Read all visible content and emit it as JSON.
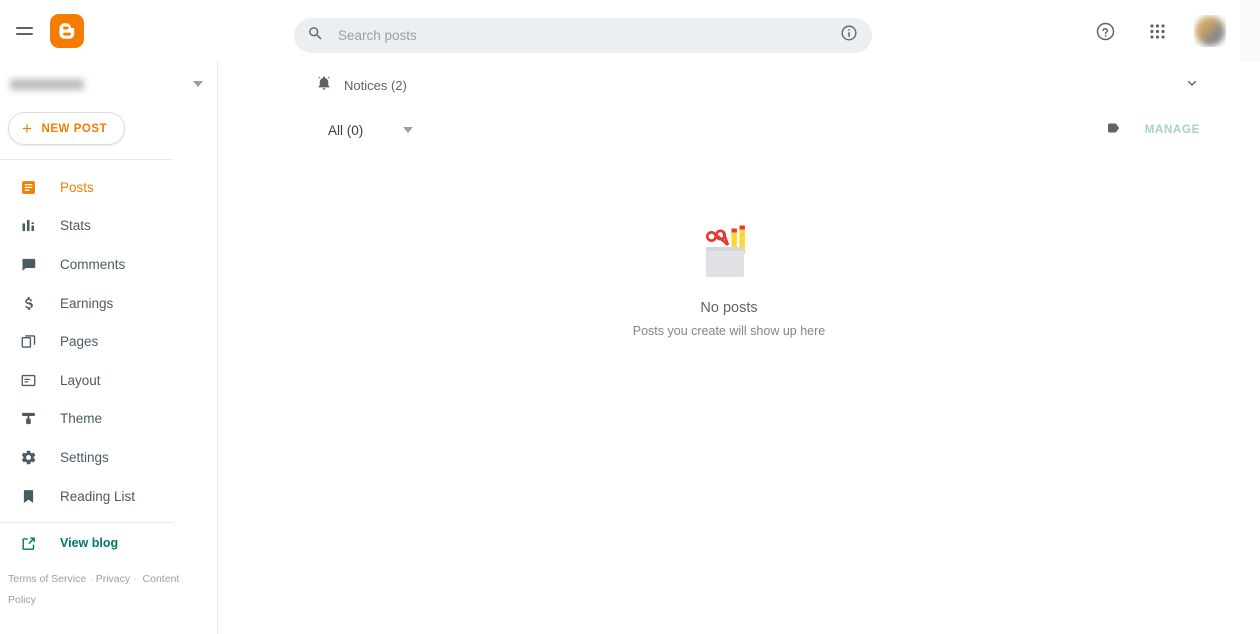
{
  "topbar": {
    "menu_icon": "hamburger-menu-icon",
    "logo_icon": "blogger-logo-icon",
    "logo_color": "#f57c00",
    "search": {
      "placeholder": "Search posts",
      "value": "",
      "search_icon": "search-icon",
      "info_icon": "info-circle-icon"
    },
    "help_icon": "help-circle-icon",
    "apps_icon": "apps-grid-icon",
    "avatar": "user-avatar"
  },
  "sidebar": {
    "blog_selector": {
      "name": "",
      "caret_icon": "chevron-down-icon"
    },
    "new_post": {
      "label": "NEW POST",
      "plus": "+"
    },
    "items": [
      {
        "label": "Posts",
        "icon": "posts-icon",
        "active": true
      },
      {
        "label": "Stats",
        "icon": "stats-icon",
        "active": false
      },
      {
        "label": "Comments",
        "icon": "comments-icon",
        "active": false
      },
      {
        "label": "Earnings",
        "icon": "earnings-icon",
        "active": false
      },
      {
        "label": "Pages",
        "icon": "pages-icon",
        "active": false
      },
      {
        "label": "Layout",
        "icon": "layout-icon",
        "active": false
      },
      {
        "label": "Theme",
        "icon": "theme-icon",
        "active": false
      },
      {
        "label": "Settings",
        "icon": "settings-icon",
        "active": false
      },
      {
        "label": "Reading List",
        "icon": "reading-list-icon",
        "active": false
      }
    ],
    "view_blog": {
      "label": "View blog",
      "icon": "external-link-icon",
      "color": "#00796b"
    },
    "footer": {
      "terms": "Terms of Service",
      "privacy": "Privacy",
      "content_policy": "Content Policy",
      "separator": "·"
    }
  },
  "main": {
    "notices": {
      "label": "Notices (2)",
      "bell_icon": "bell-icon",
      "chevron_icon": "chevron-down-icon"
    },
    "filter": {
      "label": "All (0)",
      "caret_icon": "chevron-down-icon",
      "tag_icon": "label-tag-icon",
      "manage_label": "MANAGE",
      "manage_color": "#a7cfcb"
    },
    "empty": {
      "illustration": "pencil-cup-illustration",
      "title": "No posts",
      "subtitle": "Posts you create will show up here"
    }
  },
  "colors": {
    "accent_orange": "#f57c00",
    "teal": "#00796b",
    "slate": "#4b5b63",
    "search_bg": "#eceff1"
  }
}
